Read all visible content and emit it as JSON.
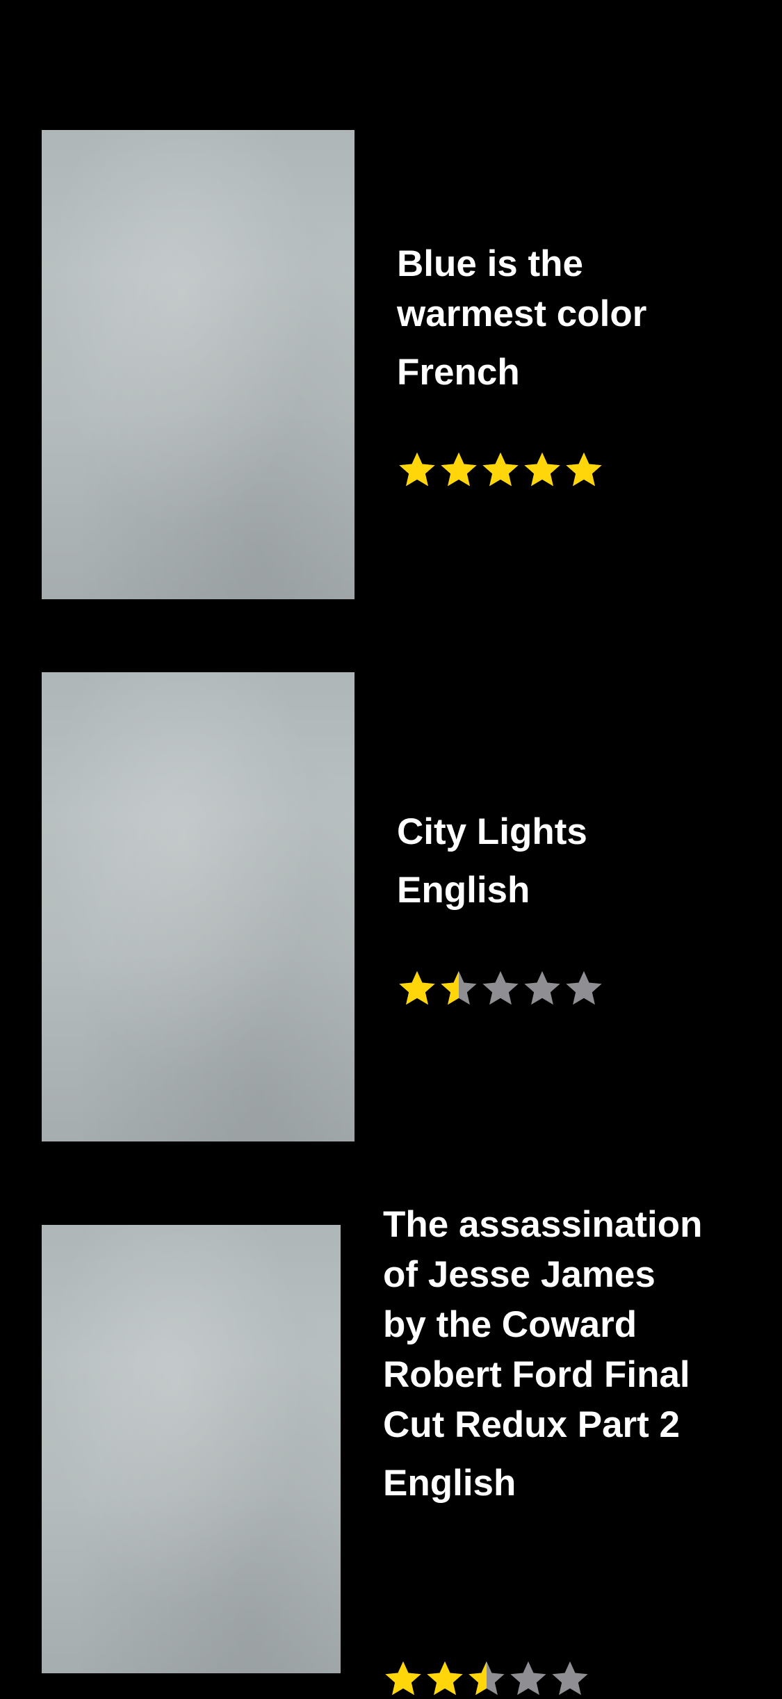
{
  "colors": {
    "background": "#000000",
    "text": "#ffffff",
    "star_filled": "#FFD60A",
    "star_empty": "#8E8E93"
  },
  "movies": [
    {
      "title": "Blue is the warmest color",
      "language": "French",
      "rating": 5,
      "rating_max": 5,
      "poster_icon": "poster-placeholder"
    },
    {
      "title": "City Lights",
      "language": "English",
      "rating": 1.5,
      "rating_max": 5,
      "poster_icon": "poster-placeholder"
    },
    {
      "title": "The assassination of Jesse James by the Coward Robert Ford Final Cut Redux Part 2",
      "language": "English",
      "rating": 2.5,
      "rating_max": 5,
      "poster_icon": "poster-placeholder"
    }
  ]
}
